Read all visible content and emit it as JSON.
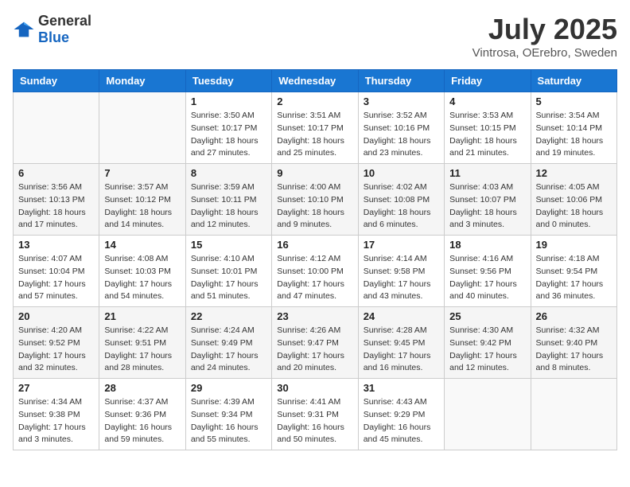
{
  "header": {
    "logo": {
      "general": "General",
      "blue": "Blue"
    },
    "title": "July 2025",
    "location": "Vintrosa, OErebro, Sweden"
  },
  "weekdays": [
    "Sunday",
    "Monday",
    "Tuesday",
    "Wednesday",
    "Thursday",
    "Friday",
    "Saturday"
  ],
  "weeks": [
    [
      {
        "day": "",
        "info": ""
      },
      {
        "day": "",
        "info": ""
      },
      {
        "day": "1",
        "info": "Sunrise: 3:50 AM\nSunset: 10:17 PM\nDaylight: 18 hours and 27 minutes."
      },
      {
        "day": "2",
        "info": "Sunrise: 3:51 AM\nSunset: 10:17 PM\nDaylight: 18 hours and 25 minutes."
      },
      {
        "day": "3",
        "info": "Sunrise: 3:52 AM\nSunset: 10:16 PM\nDaylight: 18 hours and 23 minutes."
      },
      {
        "day": "4",
        "info": "Sunrise: 3:53 AM\nSunset: 10:15 PM\nDaylight: 18 hours and 21 minutes."
      },
      {
        "day": "5",
        "info": "Sunrise: 3:54 AM\nSunset: 10:14 PM\nDaylight: 18 hours and 19 minutes."
      }
    ],
    [
      {
        "day": "6",
        "info": "Sunrise: 3:56 AM\nSunset: 10:13 PM\nDaylight: 18 hours and 17 minutes."
      },
      {
        "day": "7",
        "info": "Sunrise: 3:57 AM\nSunset: 10:12 PM\nDaylight: 18 hours and 14 minutes."
      },
      {
        "day": "8",
        "info": "Sunrise: 3:59 AM\nSunset: 10:11 PM\nDaylight: 18 hours and 12 minutes."
      },
      {
        "day": "9",
        "info": "Sunrise: 4:00 AM\nSunset: 10:10 PM\nDaylight: 18 hours and 9 minutes."
      },
      {
        "day": "10",
        "info": "Sunrise: 4:02 AM\nSunset: 10:08 PM\nDaylight: 18 hours and 6 minutes."
      },
      {
        "day": "11",
        "info": "Sunrise: 4:03 AM\nSunset: 10:07 PM\nDaylight: 18 hours and 3 minutes."
      },
      {
        "day": "12",
        "info": "Sunrise: 4:05 AM\nSunset: 10:06 PM\nDaylight: 18 hours and 0 minutes."
      }
    ],
    [
      {
        "day": "13",
        "info": "Sunrise: 4:07 AM\nSunset: 10:04 PM\nDaylight: 17 hours and 57 minutes."
      },
      {
        "day": "14",
        "info": "Sunrise: 4:08 AM\nSunset: 10:03 PM\nDaylight: 17 hours and 54 minutes."
      },
      {
        "day": "15",
        "info": "Sunrise: 4:10 AM\nSunset: 10:01 PM\nDaylight: 17 hours and 51 minutes."
      },
      {
        "day": "16",
        "info": "Sunrise: 4:12 AM\nSunset: 10:00 PM\nDaylight: 17 hours and 47 minutes."
      },
      {
        "day": "17",
        "info": "Sunrise: 4:14 AM\nSunset: 9:58 PM\nDaylight: 17 hours and 43 minutes."
      },
      {
        "day": "18",
        "info": "Sunrise: 4:16 AM\nSunset: 9:56 PM\nDaylight: 17 hours and 40 minutes."
      },
      {
        "day": "19",
        "info": "Sunrise: 4:18 AM\nSunset: 9:54 PM\nDaylight: 17 hours and 36 minutes."
      }
    ],
    [
      {
        "day": "20",
        "info": "Sunrise: 4:20 AM\nSunset: 9:52 PM\nDaylight: 17 hours and 32 minutes."
      },
      {
        "day": "21",
        "info": "Sunrise: 4:22 AM\nSunset: 9:51 PM\nDaylight: 17 hours and 28 minutes."
      },
      {
        "day": "22",
        "info": "Sunrise: 4:24 AM\nSunset: 9:49 PM\nDaylight: 17 hours and 24 minutes."
      },
      {
        "day": "23",
        "info": "Sunrise: 4:26 AM\nSunset: 9:47 PM\nDaylight: 17 hours and 20 minutes."
      },
      {
        "day": "24",
        "info": "Sunrise: 4:28 AM\nSunset: 9:45 PM\nDaylight: 17 hours and 16 minutes."
      },
      {
        "day": "25",
        "info": "Sunrise: 4:30 AM\nSunset: 9:42 PM\nDaylight: 17 hours and 12 minutes."
      },
      {
        "day": "26",
        "info": "Sunrise: 4:32 AM\nSunset: 9:40 PM\nDaylight: 17 hours and 8 minutes."
      }
    ],
    [
      {
        "day": "27",
        "info": "Sunrise: 4:34 AM\nSunset: 9:38 PM\nDaylight: 17 hours and 3 minutes."
      },
      {
        "day": "28",
        "info": "Sunrise: 4:37 AM\nSunset: 9:36 PM\nDaylight: 16 hours and 59 minutes."
      },
      {
        "day": "29",
        "info": "Sunrise: 4:39 AM\nSunset: 9:34 PM\nDaylight: 16 hours and 55 minutes."
      },
      {
        "day": "30",
        "info": "Sunrise: 4:41 AM\nSunset: 9:31 PM\nDaylight: 16 hours and 50 minutes."
      },
      {
        "day": "31",
        "info": "Sunrise: 4:43 AM\nSunset: 9:29 PM\nDaylight: 16 hours and 45 minutes."
      },
      {
        "day": "",
        "info": ""
      },
      {
        "day": "",
        "info": ""
      }
    ]
  ]
}
